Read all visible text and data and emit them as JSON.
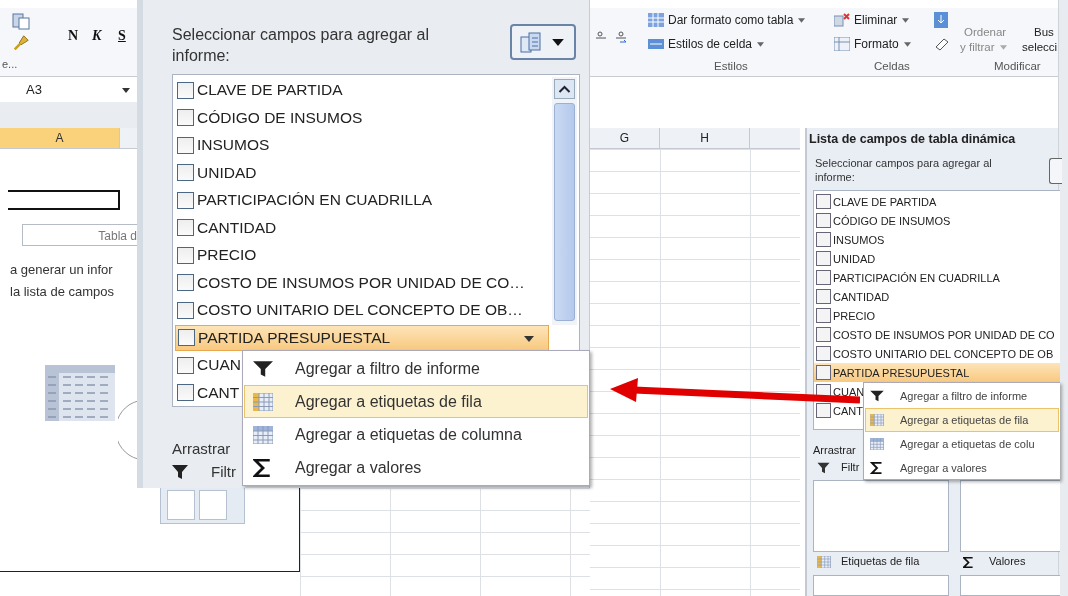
{
  "ribbon": {
    "clipboard_label": "e...",
    "font_buttons": [
      "N",
      "K",
      "S"
    ],
    "styles": {
      "format_table": "Dar formato como tabla",
      "cell_styles": "Estilos de celda",
      "label": "Estilos"
    },
    "cells": {
      "delete": "Eliminar",
      "format": "Formato",
      "label": "Celdas"
    },
    "editing": {
      "sort_line_1": "Ordenar",
      "sort_line_2": "y filtrar",
      "find_line_1": "Bus",
      "find_line_2": "selecci",
      "label": "Modificar"
    }
  },
  "name_box": {
    "value": "A3"
  },
  "columns": [
    {
      "label": "A",
      "selected": true
    },
    {
      "label": "G",
      "selected": false
    },
    {
      "label": "H",
      "selected": false
    }
  ],
  "sheet": {
    "pivot_caption": "Tabla d",
    "hint_lines": [
      "a generar un infor",
      "la lista de campos"
    ]
  },
  "zoom_panel": {
    "prompt": "Seleccionar campos para agregar al informe:",
    "fields": [
      {
        "label": "CLAVE DE PARTIDA",
        "checked": false,
        "selected": false
      },
      {
        "label": "CÓDIGO DE INSUMOS",
        "checked": false,
        "selected": false
      },
      {
        "label": "INSUMOS",
        "checked": false,
        "selected": false
      },
      {
        "label": "UNIDAD",
        "checked": false,
        "selected": false
      },
      {
        "label": "PARTICIPACIÓN EN CUADRILLA",
        "checked": false,
        "selected": false
      },
      {
        "label": "CANTIDAD",
        "checked": false,
        "selected": false
      },
      {
        "label": "PRECIO",
        "checked": false,
        "selected": false
      },
      {
        "label": "COSTO DE INSUMOS POR UNIDAD DE CO…",
        "checked": false,
        "selected": false
      },
      {
        "label": "COSTO UNITARIO DEL CONCEPTO DE OB…",
        "checked": false,
        "selected": false
      },
      {
        "label": "PARTIDA PRESUPUESTAL",
        "checked": false,
        "selected": true
      },
      {
        "label": "CUAN",
        "checked": false,
        "selected": false
      },
      {
        "label": "CANT",
        "checked": false,
        "selected": false
      }
    ],
    "context_menu": [
      {
        "kind": "filter",
        "label": "Agregar a filtro de informe",
        "selected": false
      },
      {
        "kind": "rows",
        "label": "Agregar a etiquetas de fila",
        "selected": true
      },
      {
        "kind": "columns",
        "label": "Agregar a etiquetas de columna",
        "selected": false
      },
      {
        "kind": "values",
        "label": "Agregar a valores",
        "selected": false
      }
    ],
    "areas_hint": "Arrastrar",
    "filter_area": "Filtr"
  },
  "field_list_pane": {
    "title": "Lista de campos de tabla dinámica",
    "prompt": "Seleccionar campos para agregar al informe:",
    "fields": [
      {
        "label": "CLAVE DE PARTIDA",
        "checked": false,
        "selected": false
      },
      {
        "label": "CÓDIGO DE INSUMOS",
        "checked": false,
        "selected": false
      },
      {
        "label": "INSUMOS",
        "checked": false,
        "selected": false
      },
      {
        "label": "UNIDAD",
        "checked": false,
        "selected": false
      },
      {
        "label": "PARTICIPACIÓN EN CUADRILLA",
        "checked": false,
        "selected": false
      },
      {
        "label": "CANTIDAD",
        "checked": false,
        "selected": false
      },
      {
        "label": "PRECIO",
        "checked": false,
        "selected": false
      },
      {
        "label": "COSTO DE INSUMOS POR UNIDAD DE CO",
        "checked": false,
        "selected": false
      },
      {
        "label": "COSTO UNITARIO DEL CONCEPTO DE OB",
        "checked": false,
        "selected": false
      },
      {
        "label": "PARTIDA PRESUPUESTAL",
        "checked": false,
        "selected": true
      },
      {
        "label": "CUAN",
        "checked": false,
        "selected": false
      },
      {
        "label": "CANT",
        "checked": false,
        "selected": false
      }
    ],
    "context_menu": [
      {
        "kind": "filter",
        "label": "Agregar a filtro de informe",
        "selected": false
      },
      {
        "kind": "rows",
        "label": "Agregar a etiquetas de fila",
        "selected": true
      },
      {
        "kind": "columns",
        "label": "Agregar a etiquetas de colu",
        "selected": false
      },
      {
        "kind": "values",
        "label": "Agregar a valores",
        "selected": false
      }
    ],
    "areas_hint": "Arrastrar",
    "filter_area": "Filtr",
    "row_labels_area": "Etiquetas de fila",
    "values_area": "Valores"
  }
}
